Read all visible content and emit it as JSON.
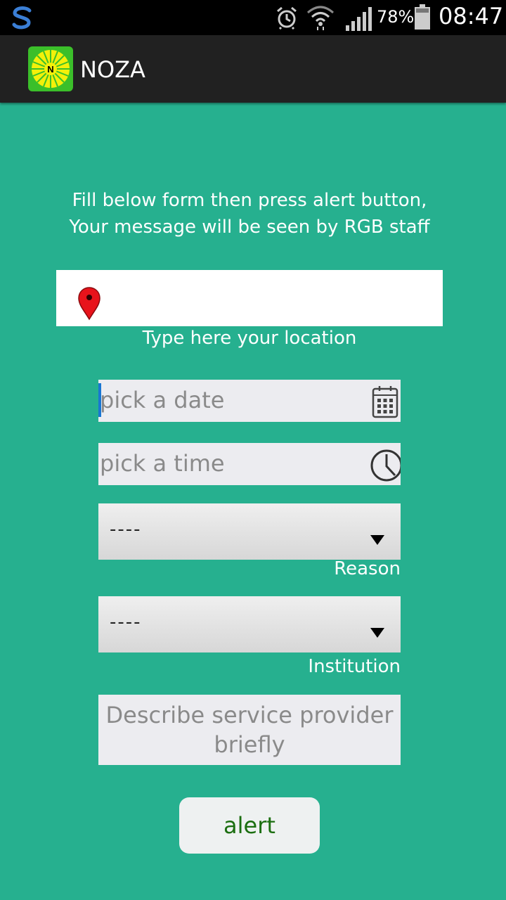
{
  "status_bar": {
    "battery_percent": "78%",
    "time": "08:47",
    "icons": [
      "s-app-icon",
      "alarm-icon",
      "wifi-icon",
      "signal-icon",
      "battery-icon"
    ]
  },
  "app_bar": {
    "title": "NOZA",
    "logo_letter": "N"
  },
  "intro": {
    "line1": "Fill below form then press alert button,",
    "line2": "Your message will be seen by RGB staff"
  },
  "location": {
    "label": "Type here your location"
  },
  "date_field": {
    "placeholder": "pick a date"
  },
  "time_field": {
    "placeholder": "pick a time"
  },
  "reason": {
    "value": "----",
    "label": "Reason"
  },
  "institution": {
    "value": "----",
    "label": "Institution"
  },
  "description": {
    "placeholder": "Describe service provider briefly"
  },
  "alert_button": {
    "label": "alert"
  },
  "colors": {
    "background": "#26b08f",
    "appbar": "#212121",
    "button_text": "#1b6e10",
    "input_bg": "#ececf0"
  }
}
